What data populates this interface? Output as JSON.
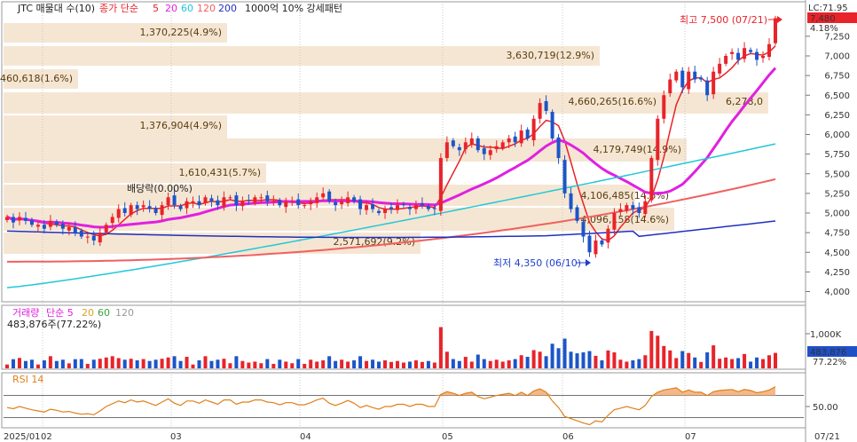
{
  "header": {
    "title": "JTC 매물대 수(10)",
    "ma_label": "종가 단순",
    "ma_periods": [
      "5",
      "20",
      "60",
      "120",
      "200"
    ],
    "ma_colors": [
      "#e8232a",
      "#e020e0",
      "#20c8d8",
      "#f06060",
      "#2030c0"
    ],
    "indicator": "1000억 10% 강세패턴",
    "last_price_label": "LC:71.95"
  },
  "price_axis": {
    "ticks": [
      "7,250",
      "7,000",
      "6,750",
      "6,500",
      "6,250",
      "6,000",
      "5,750",
      "5,500",
      "5,250",
      "5,000",
      "4,750",
      "4,500",
      "4,250",
      "4,000"
    ],
    "current_price": "7,480",
    "current_change": "4.18%"
  },
  "volume_profile": [
    {
      "label": "1,370,225(4.9%)"
    },
    {
      "label": "3,630,719(12.9%)"
    },
    {
      "label": "460,618(1.6%)"
    },
    {
      "label": "4,660,265(16.6%)"
    },
    {
      "label": "6,278,0"
    },
    {
      "label": "1,376,904(4.9%)"
    },
    {
      "label": "4,179,749(14.9%)"
    },
    {
      "label": "1,610,431(5.7%)"
    },
    {
      "label": "4,106,485(14.6%)"
    },
    {
      "label": "4,096,158(14.6%)"
    },
    {
      "label": "2,571,692(9.2%)"
    }
  ],
  "annotations": {
    "high": "최고 7,500 (07/21)",
    "low": "최저 4,350 (06/10)",
    "dividend": "배당락(0.00%)"
  },
  "volume_panel": {
    "title": "거래량",
    "ma_label": "단순 5",
    "ma_periods": [
      "20",
      "60",
      "120"
    ],
    "ma_colors": [
      "#e020e0",
      "#e0a020",
      "#40a040",
      "#999999"
    ],
    "current": "483,876주(77.22%)",
    "axis_tick": "1,000K",
    "current_value": "483,876",
    "current_pct": "77.22%"
  },
  "rsi_panel": {
    "title": "RSI 14",
    "axis_tick": "50.00"
  },
  "x_axis": {
    "labels": [
      "2025/01",
      "02",
      "03",
      "04",
      "05",
      "06",
      "07"
    ],
    "end_label": "07/21"
  },
  "chart_data": {
    "type": "candlestick",
    "price_axis_range": [
      4000,
      7500
    ],
    "x_axis_range": [
      "2025-01-02",
      "2025-07-21"
    ],
    "moving_average_periods": [
      5,
      20,
      60,
      120,
      200
    ],
    "high": {
      "value": 7500,
      "date": "07/21"
    },
    "low": {
      "value": 4350,
      "date": "06/10"
    },
    "last_close": 7480,
    "last_change_pct": 4.18,
    "close_series_approx": [
      4950,
      4880,
      4950,
      4900,
      4850,
      4850,
      4800,
      4900,
      4850,
      4800,
      4820,
      4750,
      4700,
      4700,
      4650,
      4750,
      4850,
      4950,
      5050,
      5000,
      5100,
      5050,
      5100,
      5050,
      5000,
      5100,
      5200,
      5100,
      5050,
      5150,
      5150,
      5100,
      5200,
      5150,
      5100,
      5200,
      5200,
      5100,
      5150,
      5150,
      5200,
      5200,
      5150,
      5150,
      5100,
      5150,
      5150,
      5100,
      5100,
      5150,
      5200,
      5250,
      5150,
      5100,
      5150,
      5200,
      5150,
      5050,
      5100,
      5050,
      5000,
      5050,
      5050,
      5100,
      5100,
      5050,
      5100,
      5100,
      5050,
      5050,
      5700,
      5900,
      5850,
      5800,
      5900,
      5950,
      5800,
      5750,
      5800,
      5850,
      5900,
      5950,
      5900,
      6050,
      5950,
      6200,
      6400,
      6300,
      5950,
      5700,
      5250,
      5050,
      4900,
      4700,
      4500,
      4650,
      4600,
      4800,
      5000,
      5050,
      5100,
      5050,
      5000,
      5150,
      5700,
      6200,
      6500,
      6700,
      6800,
      6600,
      6800,
      6700,
      6700,
      6500,
      6800,
      6900,
      7000,
      7050,
      6950,
      7100,
      7050,
      6950,
      7000,
      7150,
      7480
    ],
    "volume_panel": {
      "axis_tick": 1000000,
      "last_volume": 483876,
      "last_volume_pct": 77.22
    },
    "rsi": {
      "period": 14,
      "axis_tick": 50,
      "series_approx": [
        48,
        46,
        50,
        47,
        44,
        42,
        40,
        45,
        43,
        40,
        41,
        38,
        36,
        37,
        35,
        42,
        50,
        55,
        60,
        57,
        62,
        58,
        60,
        56,
        52,
        58,
        64,
        56,
        52,
        60,
        60,
        56,
        62,
        58,
        54,
        62,
        62,
        54,
        58,
        58,
        62,
        62,
        58,
        57,
        53,
        57,
        57,
        53,
        53,
        57,
        62,
        65,
        56,
        52,
        56,
        61,
        56,
        48,
        52,
        48,
        45,
        50,
        50,
        54,
        54,
        50,
        54,
        54,
        50,
        50,
        72,
        77,
        74,
        70,
        74,
        76,
        68,
        64,
        67,
        70,
        72,
        74,
        70,
        76,
        70,
        78,
        82,
        76,
        60,
        48,
        32,
        28,
        24,
        20,
        17,
        24,
        22,
        34,
        44,
        47,
        50,
        47,
        44,
        52,
        68,
        76,
        80,
        82,
        84,
        76,
        80,
        76,
        76,
        70,
        77,
        79,
        80,
        81,
        77,
        81,
        79,
        75,
        77,
        80,
        86
      ]
    }
  }
}
